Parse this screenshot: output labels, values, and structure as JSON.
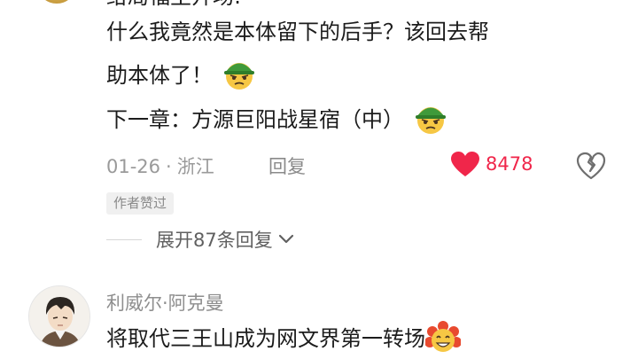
{
  "comment1": {
    "text_line0": "给局福主开场:",
    "text_line1": "什么我竟然是本体留下的后手？该回去帮",
    "text_line2": "助本体了！",
    "text_line3": "下一章：方源巨阳战星宿（中）",
    "emoji_name": "soldier-helmet-emoji",
    "date": "01-26",
    "separator": "·",
    "location": "浙江",
    "reply_label": "回复",
    "like_count": "8478",
    "like_color": "#f0264a",
    "author_badge": "作者赞过",
    "expand_label": "展开87条回复"
  },
  "comment2": {
    "username": "利威尔·阿克曼",
    "text": "将取代三王山成为网文界第一转场",
    "emoji_name": "grinning-flower-emoji"
  }
}
